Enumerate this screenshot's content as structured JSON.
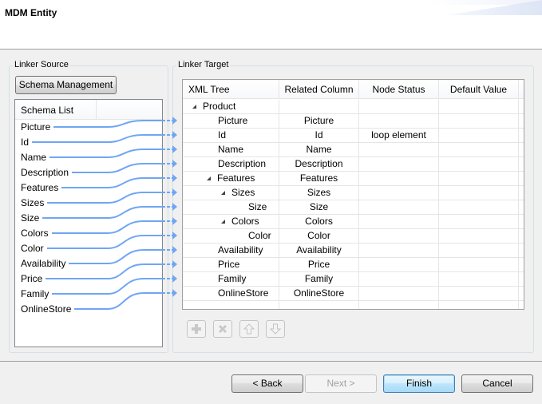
{
  "window": {
    "title": "MDM Entity"
  },
  "source": {
    "group_label": "Linker Source",
    "schema_button": "Schema Management",
    "list_header": "Schema List",
    "items": [
      "Picture",
      "Id",
      "Name",
      "Description",
      "Features",
      "Sizes",
      "Size",
      "Colors",
      "Color",
      "Availability",
      "Price",
      "Family",
      "OnlineStore"
    ]
  },
  "target": {
    "group_label": "Linker Target",
    "columns": [
      "XML Tree",
      "Related Column",
      "Node Status",
      "Default Value"
    ],
    "rows": [
      {
        "tree": "Product",
        "level": 0,
        "expandable": true,
        "related": "",
        "status": "",
        "default": ""
      },
      {
        "tree": "Picture",
        "level": 2,
        "expandable": false,
        "related": "Picture",
        "status": "",
        "default": ""
      },
      {
        "tree": "Id",
        "level": 2,
        "expandable": false,
        "related": "Id",
        "status": "loop element",
        "default": ""
      },
      {
        "tree": "Name",
        "level": 2,
        "expandable": false,
        "related": "Name",
        "status": "",
        "default": ""
      },
      {
        "tree": "Description",
        "level": 2,
        "expandable": false,
        "related": "Description",
        "status": "",
        "default": ""
      },
      {
        "tree": "Features",
        "level": 1,
        "expandable": true,
        "related": "Features",
        "status": "",
        "default": ""
      },
      {
        "tree": "Sizes",
        "level": 2,
        "expandable": true,
        "related": "Sizes",
        "status": "",
        "default": ""
      },
      {
        "tree": "Size",
        "level": 4,
        "expandable": false,
        "related": "Size",
        "status": "",
        "default": ""
      },
      {
        "tree": "Colors",
        "level": 2,
        "expandable": true,
        "related": "Colors",
        "status": "",
        "default": ""
      },
      {
        "tree": "Color",
        "level": 4,
        "expandable": false,
        "related": "Color",
        "status": "",
        "default": ""
      },
      {
        "tree": "Availability",
        "level": 2,
        "expandable": false,
        "related": "Availability",
        "status": "",
        "default": ""
      },
      {
        "tree": "Price",
        "level": 2,
        "expandable": false,
        "related": "Price",
        "status": "",
        "default": ""
      },
      {
        "tree": "Family",
        "level": 2,
        "expandable": false,
        "related": "Family",
        "status": "",
        "default": ""
      },
      {
        "tree": "OnlineStore",
        "level": 2,
        "expandable": false,
        "related": "OnlineStore",
        "status": "",
        "default": ""
      }
    ],
    "toolbar": [
      {
        "name": "add-icon",
        "glyph": "+"
      },
      {
        "name": "delete-icon",
        "glyph": "✖"
      },
      {
        "name": "move-up-icon",
        "glyph": "⇧"
      },
      {
        "name": "move-down-icon",
        "glyph": "⇩"
      }
    ]
  },
  "links": {
    "color": "#6fa6f3",
    "pairs": [
      {
        "source": "Picture",
        "target": "Picture"
      },
      {
        "source": "Id",
        "target": "Id"
      },
      {
        "source": "Name",
        "target": "Name"
      },
      {
        "source": "Description",
        "target": "Description"
      },
      {
        "source": "Features",
        "target": "Features"
      },
      {
        "source": "Sizes",
        "target": "Sizes"
      },
      {
        "source": "Size",
        "target": "Size"
      },
      {
        "source": "Colors",
        "target": "Colors"
      },
      {
        "source": "Color",
        "target": "Color"
      },
      {
        "source": "Availability",
        "target": "Availability"
      },
      {
        "source": "Price",
        "target": "Price"
      },
      {
        "source": "Family",
        "target": "Family"
      },
      {
        "source": "OnlineStore",
        "target": "OnlineStore"
      }
    ]
  },
  "footer": {
    "back": "< Back",
    "next": "Next >",
    "finish": "Finish",
    "cancel": "Cancel"
  }
}
